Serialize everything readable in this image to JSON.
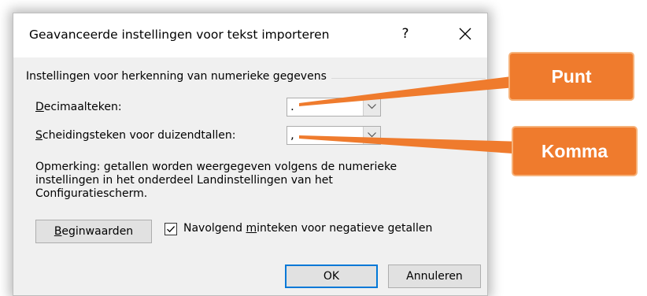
{
  "dialog": {
    "title": "Geavanceerde instellingen voor tekst importeren",
    "help_label": "?",
    "close_label": "✕"
  },
  "group": {
    "label": "Instellingen voor herkenning van numerieke gegevens"
  },
  "decimal": {
    "label_key": "D",
    "label_rest": "ecimaalteken:",
    "value": "."
  },
  "thousands": {
    "label_key": "S",
    "label_rest": "cheidingsteken voor duizendtallen:",
    "value": ","
  },
  "note": {
    "line1": "Opmerking: getallen worden weergegeven volgens de numerieke",
    "line2": "instellingen in het onderdeel Landinstellingen van het",
    "line3": "Configuratiescherm."
  },
  "reset_button": {
    "label_key": "B",
    "label_rest": "eginwaarden"
  },
  "negative_checkbox": {
    "checked": true,
    "label_before": "Navolgend ",
    "label_key": "m",
    "label_after": "inteken voor negatieve getallen"
  },
  "ok_button": {
    "label": "OK"
  },
  "cancel_button": {
    "label": "Annuleren"
  },
  "callouts": {
    "decimal_label": "Punt",
    "thousands_label": "Komma",
    "color": "#ef7b2d"
  },
  "colors": {
    "dialog_bg": "#f0f0f0",
    "titlebar_bg": "#ffffff",
    "default_button_border": "#0078d7"
  }
}
